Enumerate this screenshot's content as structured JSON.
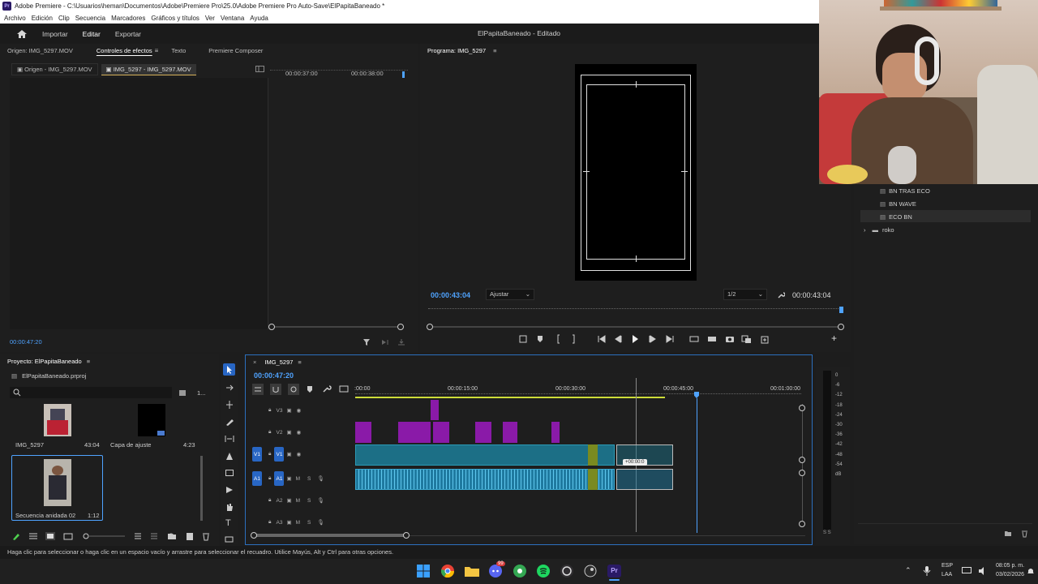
{
  "window": {
    "title": "Adobe Premiere - C:\\Usuarios\\heman\\Documentos\\Adobe\\Premiere Pro\\25.0\\Adobe Premiere Pro Auto-Save\\ElPapitaBaneado *"
  },
  "menu": [
    "Archivo",
    "Edición",
    "Clip",
    "Secuencia",
    "Marcadores",
    "Gráficos y títulos",
    "Ver",
    "Ventana",
    "Ayuda"
  ],
  "topbar": {
    "tabs": [
      "Importar",
      "Editar",
      "Exportar"
    ],
    "active_tab": "Editar",
    "doc_title": "ElPapitaBaneado - Editado"
  },
  "source_panel": {
    "tabs": [
      "Origen: IMG_5297.MOV",
      "Controles de efectos",
      "Texto",
      "Premiere Composer"
    ],
    "subtabs": [
      "Origen - IMG_5297.MOV",
      "IMG_5297 - IMG_5297.MOV"
    ],
    "ruler": [
      "00:00:37:00",
      "00:00:38:00"
    ],
    "timecode": "00:00:47:20"
  },
  "program_monitor": {
    "title": "Programa: IMG_5297",
    "timecode_left": "00:00:43:04",
    "fit": "Ajustar",
    "resolution": "1/2",
    "timecode_right": "00:00:43:04"
  },
  "effects_list": {
    "items": [
      "BN TRAS ECO",
      "BN WAVE",
      "ECO BN"
    ],
    "folder": "roko"
  },
  "project_panel": {
    "title": "Proyecto: ElPapitaBaneado",
    "file": "ElPapitaBaneado.prproj",
    "count": "1...",
    "items": [
      {
        "name": "IMG_5297",
        "duration": "43:04"
      },
      {
        "name": "Capa de ajuste",
        "duration": "4:23"
      },
      {
        "name": "Secuencia anidada 02",
        "duration": "1:12"
      }
    ]
  },
  "timeline": {
    "sequence": "IMG_5297",
    "timecode": "00:00:47:20",
    "ruler": [
      ":00:00",
      "00:00:15:00",
      "00:00:30:00",
      "00:00:45:00",
      "00:01:00:00"
    ],
    "tracks": {
      "video": [
        "V3",
        "V2",
        "V1"
      ],
      "audio": [
        "A1",
        "A2",
        "A3"
      ],
      "source_v": "V1",
      "source_a": "A1",
      "m": "M",
      "s": "S"
    },
    "drag_tooltip": "+00:00:0"
  },
  "meter": {
    "scale": [
      "0",
      "-6",
      "-12",
      "-18",
      "-24",
      "-30",
      "-36",
      "-42",
      "-48",
      "-54",
      "dB"
    ],
    "bottom": "S S"
  },
  "status": "Haga clic para seleccionar o haga clic en un espacio vacío y arrastre para seleccionar el recuadro. Utilice Mayús, Alt y Ctrl para otras opciones.",
  "taskbar": {
    "lang1": "ESP",
    "lang2": "LAA",
    "time": "08:05 p. m.",
    "date": "03/02/2026",
    "badge": "99"
  },
  "colors": {
    "accent_blue": "#4fa3ff",
    "video_clip": "#1c6f86",
    "audio_clip": "#1f7aa0",
    "adjustment_clip": "#8a1aa8"
  }
}
